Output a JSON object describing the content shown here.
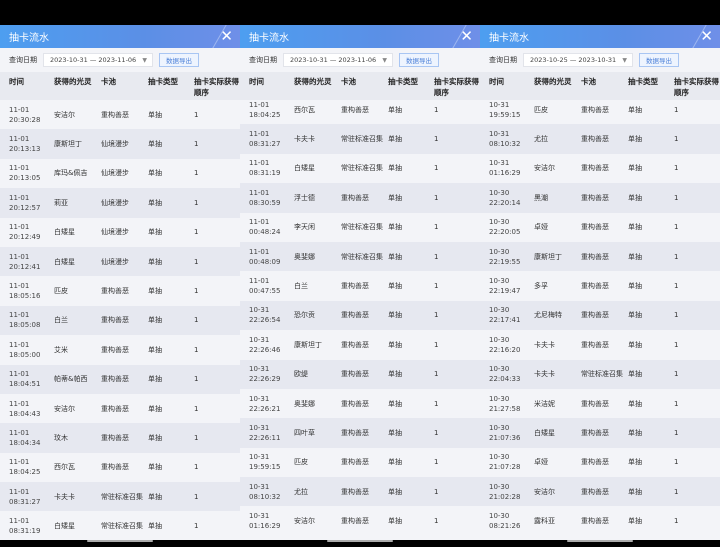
{
  "columns": [
    "时间",
    "获得的光灵",
    "卡池",
    "抽卡类型",
    "抽卡实际获得顺序"
  ],
  "colors": {
    "header_start": "#4d9ef0",
    "header_end": "#6f8fe8",
    "export_text": "#4a7fd8"
  },
  "panels": [
    {
      "title": "抽卡流水",
      "close_icon": "close-icon",
      "filter_label": "查询日期",
      "date_range": "2023-10-31 — 2023-11-06",
      "export_label": "数据导出",
      "rows": [
        [
          "11-01 20:30:28",
          "安洁尔",
          "重构善恶",
          "单抽",
          "1"
        ],
        [
          "11-01 20:13:13",
          "康斯坦丁",
          "仙境漫步",
          "单抽",
          "1"
        ],
        [
          "11-01 20:13:05",
          "库玛&佩吉",
          "仙境漫步",
          "单抽",
          "1"
        ],
        [
          "11-01 20:12:57",
          "莉亚",
          "仙境漫步",
          "单抽",
          "1"
        ],
        [
          "11-01 20:12:49",
          "白矮星",
          "仙境漫步",
          "单抽",
          "1"
        ],
        [
          "11-01 20:12:41",
          "白矮星",
          "仙境漫步",
          "单抽",
          "1"
        ],
        [
          "11-01 18:05:16",
          "匹皮",
          "重构善恶",
          "单抽",
          "1"
        ],
        [
          "11-01 18:05:08",
          "白兰",
          "重构善恶",
          "单抽",
          "1"
        ],
        [
          "11-01 18:05:00",
          "艾米",
          "重构善恶",
          "单抽",
          "1"
        ],
        [
          "11-01 18:04:51",
          "帕蒂&帕西",
          "重构善恶",
          "单抽",
          "1"
        ],
        [
          "11-01 18:04:43",
          "安洁尔",
          "重构善恶",
          "单抽",
          "1"
        ],
        [
          "11-01 18:04:34",
          "玟木",
          "重构善恶",
          "单抽",
          "1"
        ],
        [
          "11-01 18:04:25",
          "西尔瓦",
          "重构善恶",
          "单抽",
          "1"
        ],
        [
          "11-01 08:31:27",
          "卡夫卡",
          "常驻标准召集",
          "单抽",
          "1"
        ],
        [
          "11-01 08:31:19",
          "白矮星",
          "常驻标准召集",
          "单抽",
          "1"
        ]
      ]
    },
    {
      "title": "抽卡流水",
      "close_icon": "close-icon",
      "filter_label": "查询日期",
      "date_range": "2023-10-31 — 2023-11-06",
      "export_label": "数据导出",
      "rows": [
        [
          "11-01 18:04:25",
          "西尔瓦",
          "重构善恶",
          "单抽",
          "1"
        ],
        [
          "11-01 08:31:27",
          "卡夫卡",
          "常驻标准召集",
          "单抽",
          "1"
        ],
        [
          "11-01 08:31:19",
          "白矮星",
          "常驻标准召集",
          "单抽",
          "1"
        ],
        [
          "11-01 08:30:59",
          "浮士德",
          "重构善恶",
          "单抽",
          "1"
        ],
        [
          "11-01 00:48:24",
          "李天闲",
          "常驻标准召集",
          "单抽",
          "1"
        ],
        [
          "11-01 00:48:09",
          "奥斐娜",
          "常驻标准召集",
          "单抽",
          "1"
        ],
        [
          "11-01 00:47:55",
          "白兰",
          "重构善恶",
          "单抽",
          "1"
        ],
        [
          "10-31 22:26:54",
          "恐尔贡",
          "重构善恶",
          "单抽",
          "1"
        ],
        [
          "10-31 22:26:46",
          "康斯坦丁",
          "重构善恶",
          "单抽",
          "1"
        ],
        [
          "10-31 22:26:29",
          "欧缇",
          "重构善恶",
          "单抽",
          "1"
        ],
        [
          "10-31 22:26:21",
          "奥斐娜",
          "重构善恶",
          "单抽",
          "1"
        ],
        [
          "10-31 22:26:11",
          "四叶草",
          "重构善恶",
          "单抽",
          "1"
        ],
        [
          "10-31 19:59:15",
          "匹皮",
          "重构善恶",
          "单抽",
          "1"
        ],
        [
          "10-31 08:10:32",
          "尤拉",
          "重构善恶",
          "单抽",
          "1"
        ],
        [
          "10-31 01:16:29",
          "安洁尔",
          "重构善恶",
          "单抽",
          "1"
        ]
      ]
    },
    {
      "title": "抽卡流水",
      "close_icon": "close-icon",
      "filter_label": "查询日期",
      "date_range": "2023-10-25 — 2023-10-31",
      "export_label": "数据导出",
      "rows": [
        [
          "10-31 19:59:15",
          "匹皮",
          "重构善恶",
          "单抽",
          "1"
        ],
        [
          "10-31 08:10:32",
          "尤拉",
          "重构善恶",
          "单抽",
          "1"
        ],
        [
          "10-31 01:16:29",
          "安洁尔",
          "重构善恶",
          "单抽",
          "1"
        ],
        [
          "10-30 22:20:14",
          "黑潮",
          "重构善恶",
          "单抽",
          "1"
        ],
        [
          "10-30 22:20:05",
          "卓娅",
          "重构善恶",
          "单抽",
          "1"
        ],
        [
          "10-30 22:19:55",
          "康斯坦丁",
          "重构善恶",
          "单抽",
          "1"
        ],
        [
          "10-30 22:19:47",
          "多孚",
          "重构善恶",
          "单抽",
          "1"
        ],
        [
          "10-30 22:17:41",
          "尤尼梅特",
          "重构善恶",
          "单抽",
          "1"
        ],
        [
          "10-30 22:16:20",
          "卡夫卡",
          "重构善恶",
          "单抽",
          "1"
        ],
        [
          "10-30 22:04:33",
          "卡夫卡",
          "常驻标准召集",
          "单抽",
          "1"
        ],
        [
          "10-30 21:27:58",
          "米洁妮",
          "重构善恶",
          "单抽",
          "1"
        ],
        [
          "10-30 21:07:36",
          "白矮星",
          "重构善恶",
          "单抽",
          "1"
        ],
        [
          "10-30 21:07:28",
          "卓娅",
          "重构善恶",
          "单抽",
          "1"
        ],
        [
          "10-30 21:02:28",
          "安洁尔",
          "重构善恶",
          "单抽",
          "1"
        ],
        [
          "10-30 08:21:26",
          "露科亚",
          "重构善恶",
          "单抽",
          "1"
        ]
      ]
    }
  ]
}
